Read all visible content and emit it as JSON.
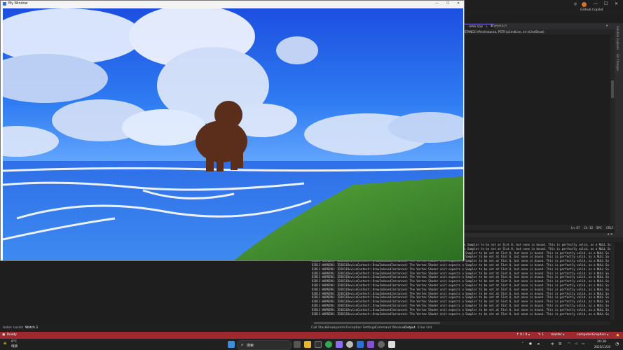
{
  "game_window": {
    "title": "My Window",
    "controls": {
      "minimize": "—",
      "maximize": "☐",
      "close": "✕"
    }
  },
  "vs": {
    "copilot": "GitHub Copilot",
    "window_controls": {
      "minimize": "—",
      "maximize": "☐",
      "close": "✕"
    },
    "tabs": [
      {
        "label": "...ame.cpp"
      },
      {
        "label": "Camera.h"
      }
    ],
    "signature": "STANCE hPrevInstance, PSTR lpCmdLine, int nCmdShow)",
    "right_panels": [
      "Solution Explorer",
      "Git Changes"
    ],
    "editor_status": {
      "line": "Ln: 67",
      "col": "Ch: 32",
      "spc": "SPC",
      "eol": "CRLF"
    },
    "output_header": "▾ ✕",
    "output_lines": [
      "a Sampler to be set at Slot 0, but none is bound. This is perfectly valid, as a NULL Sa",
      "a Sampler to be set at Slot 0, but none is bound. This is perfectly valid, as a NULL Sa",
      "D3D11 WARNING: ID3D11DeviceContext::DrawIndexedInstanced: The Vertex Shader unit expects a Sampler to be set at Slot 0, but none is bound. This is perfectly valid, as a NULL Sa",
      "D3D11 WARNING: ID3D11DeviceContext::DrawIndexedInstanced: The Vertex Shader unit expects a Sampler to be set at Slot 0, but none is bound. This is perfectly valid, as a NULL Sa",
      "D3D11 WARNING: ID3D11DeviceContext::DrawIndexedInstanced: The Vertex Shader unit expects a Sampler to be set at Slot 0, but none is bound. This is perfectly valid, as a NULL Sa",
      "D3D11 WARNING: ID3D11DeviceContext::DrawIndexedInstanced: The Vertex Shader unit expects a Sampler to be set at Slot 0, but none is bound. This is perfectly valid, as a NULL Sa",
      "D3D11 WARNING: ID3D11DeviceContext::DrawIndexedInstanced: The Vertex Shader unit expects a Sampler to be set at Slot 0, but none is bound. This is perfectly valid, as a NULL Sa",
      "D3D11 WARNING: ID3D11DeviceContext::DrawIndexedInstanced: The Vertex Shader unit expects a Sampler to be set at Slot 0, but none is bound. This is perfectly valid, as a NULL Sa",
      "D3D11 WARNING: ID3D11DeviceContext::DrawIndexedInstanced: The Vertex Shader unit expects a Sampler to be set at Slot 0, but none is bound. This is perfectly valid, as a NULL Sa",
      "D3D11 WARNING: ID3D11DeviceContext::DrawIndexedInstanced: The Vertex Shader unit expects a Sampler to be set at Slot 0, but none is bound. This is perfectly valid, as a NULL Sa",
      "D3D11 WARNING: ID3D11DeviceContext::DrawIndexedInstanced: The Vertex Shader unit expects a Sampler to be set at Slot 0, but none is bound. This is perfectly valid, as a NULL Sa",
      "D3D11 WARNING: ID3D11DeviceContext::DrawIndexedInstanced: The Vertex Shader unit expects a Sampler to be set at Slot 0, but none is bound. This is perfectly valid, as a NULL Sa",
      "D3D11 WARNING: ID3D11DeviceContext::DrawIndexedInstanced: The Vertex Shader unit expects a Sampler to be set at Slot 0, but none is bound. This is perfectly valid, as a NULL Sa",
      "D3D11 WARNING: ID3D11DeviceContext::DrawIndexedInstanced: The Vertex Shader unit expects a Sampler to be set at Slot 0, but none is bound. This is perfectly valid, as a NULL Sa",
      "D3D11 WARNING: ID3D11DeviceContext::DrawIndexedInstanced: The Vertex Shader unit expects a Sampler to be set at Slot 0, but none is bound. This is perfectly valid, as a NULL Sa",
      "D3D11 WARNING: ID3D11DeviceContext::DrawIndexedInstanced: The Vertex Shader unit expects a Sampler to be set at Slot 0, but none is bound. This is perfectly valid, as a NULL Sa",
      "D3D11 WARNING: ID3D11DeviceContext::DrawIndexedInstanced: The Vertex Shader unit expects a Sampler to be set at Slot 0, but none is bound. This is perfectly valid, as a NULL Sa",
      "D3D11 WARNING: ID3D11DeviceContext::DrawIndexedInstanced: The Vertex Shader unit expects a Sampler to be set at Slot 0, but none is bound. This is perfectly valid, as a NULL Sa"
    ],
    "bottom_tabs_left": [
      "Autos",
      "Locals",
      "Watch 1"
    ],
    "bottom_tabs_right": [
      "Call Stack",
      "Breakpoints",
      "Exception Settings",
      "Command Window",
      "Output",
      "Error List"
    ],
    "status": {
      "ready": "Ready",
      "changes": "↑ 0 / 0 ▴",
      "pencil": "✎ 1",
      "branch": "master ▴",
      "repo": "computerGraphics ▴",
      "bell": "🔔"
    }
  },
  "taskbar": {
    "weather_temp": "9°C",
    "weather_desc": "晴朗",
    "search_placeholder": "搜索",
    "time": "20:38",
    "date": "2025/11/30",
    "lang": "中",
    "colors": {
      "accent": "#9e2a2f",
      "taskbar": "#202020",
      "sky": "#1f5fe6",
      "grass": "#3d8a2e"
    }
  }
}
